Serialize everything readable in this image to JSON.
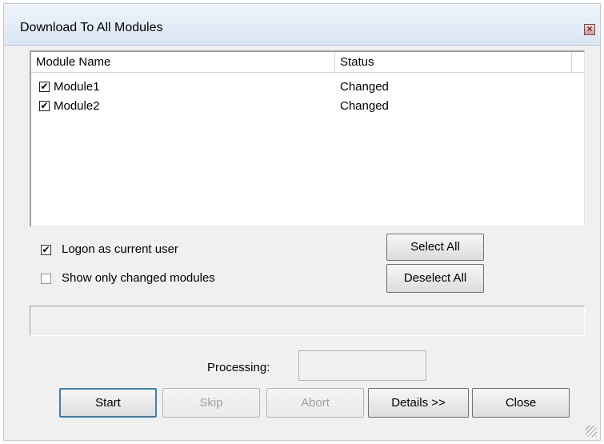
{
  "window": {
    "title": "Download To All Modules",
    "close_glyph": "×"
  },
  "list": {
    "columns": [
      "Module Name",
      "Status"
    ],
    "rows": [
      {
        "name": "Module1",
        "status": "Changed",
        "checked": true
      },
      {
        "name": "Module2",
        "status": "Changed",
        "checked": true
      }
    ]
  },
  "options": {
    "logon_label": "Logon as current user",
    "logon_checked": true,
    "show_changed_label": "Show only changed modules",
    "show_changed_checked": false,
    "check_glyph": "✔"
  },
  "buttons": {
    "select_all": "Select All",
    "deselect_all": "Deselect All",
    "start": "Start",
    "skip": "Skip",
    "abort": "Abort",
    "details": "Details >>",
    "close": "Close"
  },
  "processing": {
    "label": "Processing:",
    "value": ""
  }
}
